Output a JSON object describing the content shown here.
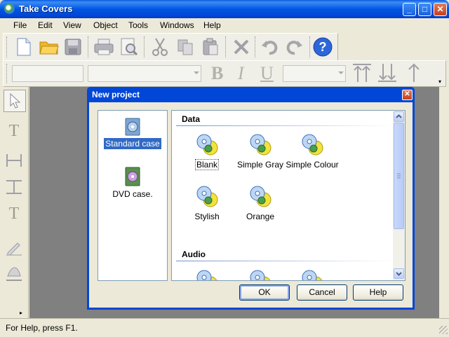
{
  "window": {
    "title": "Take Covers"
  },
  "menu": [
    "File",
    "Edit",
    "View",
    "Object",
    "Tools",
    "Windows",
    "Help"
  ],
  "toolbar": {
    "icons": [
      "new-file-icon",
      "open-folder-icon",
      "save-icon",
      "print-icon",
      "print-preview-icon",
      "cut-icon",
      "copy-icon",
      "paste-icon",
      "delete-icon",
      "undo-icon",
      "redo-icon",
      "help-icon"
    ]
  },
  "format_bar": {
    "bold": "B",
    "italic": "I",
    "underline": "U"
  },
  "status": {
    "text": "For Help, press F1."
  },
  "dialog": {
    "title": "New project",
    "categories": [
      {
        "label": "Standard case"
      },
      {
        "label": "DVD case."
      }
    ],
    "sections": {
      "data": "Data",
      "audio": "Audio"
    },
    "templates": [
      {
        "label": "Blank"
      },
      {
        "label": "Simple Gray"
      },
      {
        "label": "Simple Colour"
      },
      {
        "label": "Stylish"
      },
      {
        "label": "Orange"
      }
    ],
    "buttons": {
      "ok": "OK",
      "cancel": "Cancel",
      "help": "Help"
    }
  },
  "colors": {
    "titlebar": "#0055e5",
    "selection": "#316ac5",
    "workspace": "#808080"
  }
}
